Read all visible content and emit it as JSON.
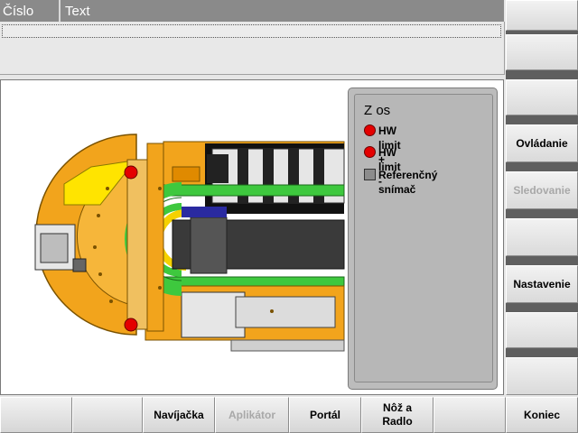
{
  "messages": {
    "columns": [
      "Číslo",
      "Text"
    ],
    "rows": []
  },
  "axis_panel": {
    "title": "Z os",
    "items": [
      {
        "label": "HW limit  +",
        "indicator": "red-led"
      },
      {
        "label": "HW limit  -",
        "indicator": "red-led"
      },
      {
        "label": "Referenčný\nsnímač",
        "indicator": "gray-square"
      }
    ]
  },
  "right_softkeys": [
    {
      "label": "",
      "enabled": true
    },
    {
      "label": "",
      "enabled": true
    },
    {
      "label": "",
      "enabled": true
    },
    {
      "label": "Ovládanie",
      "enabled": true
    },
    {
      "label": "Sledovanie",
      "enabled": false
    },
    {
      "label": "",
      "enabled": true
    },
    {
      "label": "Nastavenie",
      "enabled": true
    },
    {
      "label": "",
      "enabled": true
    },
    {
      "label": "",
      "enabled": true
    }
  ],
  "bottom_softkeys": [
    {
      "label": "",
      "enabled": true
    },
    {
      "label": "",
      "enabled": true
    },
    {
      "label": "Navíjačka",
      "enabled": true
    },
    {
      "label": "Aplikátor",
      "enabled": false
    },
    {
      "label": "Portál",
      "enabled": true
    },
    {
      "label": "Nôž a\nRadlo",
      "enabled": true
    },
    {
      "label": "",
      "enabled": true
    },
    {
      "label": "Koniec",
      "enabled": true
    }
  ],
  "colors": {
    "machine_orange": "#f2a41c",
    "chain_green": "#3ec83e",
    "limit_red": "#e40000",
    "header_gray": "#8a8a8a",
    "separator_dark": "#5f5f5f"
  }
}
